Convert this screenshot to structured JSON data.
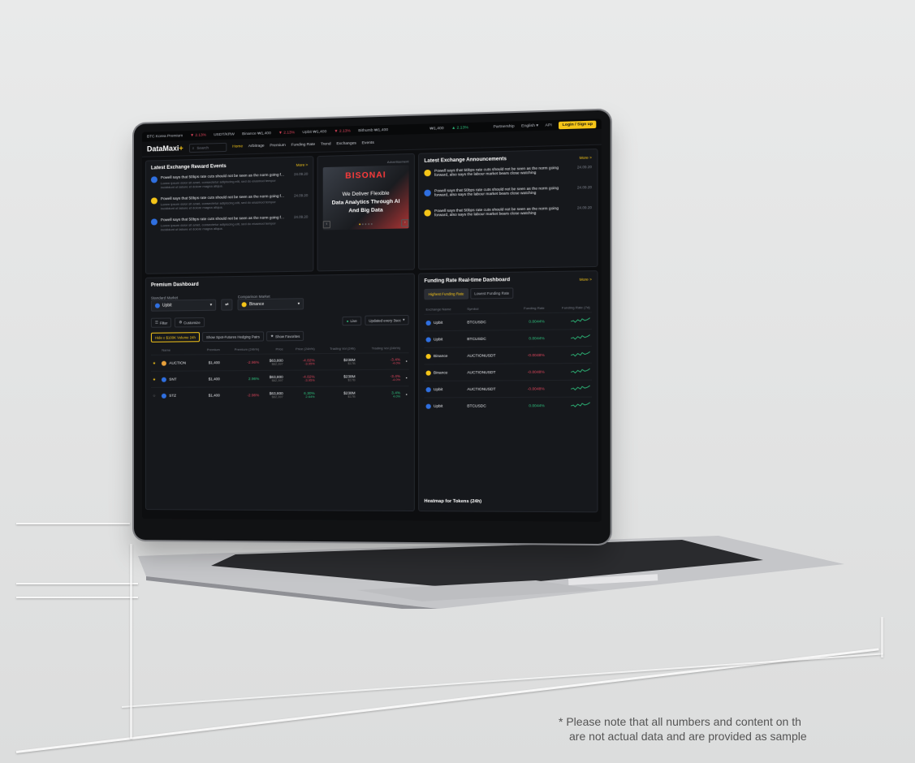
{
  "ticker": {
    "kp_label": "BTC Korea Premium",
    "kp_value": "▼ 2.13%",
    "usd_label": "USDT/KRW",
    "binance": "Binance ₩1,400",
    "binance_change": "▼ 2.13%",
    "upbit": "Upbit ₩1,400",
    "upbit_change": "▼ 2.13%",
    "bithumb": "Bithumb ₩1,400",
    "center": "₩1,400",
    "center_change": "▲ 2.13%",
    "partnership": "Partnership",
    "language": "English",
    "api": "API",
    "login": "Login / Sign up"
  },
  "nav": {
    "logo_main": "DataMaxi",
    "logo_plus": "+",
    "search_placeholder": "Search",
    "items": [
      "Home",
      "Arbitrage",
      "Premium",
      "Funding Rate",
      "Trend",
      "Exchanges",
      "Events"
    ]
  },
  "rewards": {
    "title": "Latest Exchange Reward Events",
    "more": "More >",
    "events": [
      {
        "title": "Powell says that 50bps rate cuts should not be seen as the norm going f...",
        "desc": "Lorem ipsum dolor sit amet, consectetur adipiscing elit, sed do eiusmod tempor incididunt ut labore et dolore magna aliqua.",
        "date": "24.09.20",
        "color": "#2f6fe0"
      },
      {
        "title": "Powell says that 50bps rate cuts should not be seen as the norm going f...",
        "desc": "Lorem ipsum dolor sit amet, consectetur adipiscing elit, sed do eiusmod tempor incididunt ut labore et dolore magna aliqua.",
        "date": "24.09.20",
        "color": "#f5c518"
      },
      {
        "title": "Powell says that 50bps rate cuts should not be seen as the norm going f...",
        "desc": "Lorem ipsum dolor sit amet, consectetur adipiscing elit, sed do eiusmod tempor incididunt ut labore et dolore magna aliqua.",
        "date": "24.09.20",
        "color": "#2f6fe0"
      }
    ]
  },
  "ad": {
    "label": "Advertisement",
    "brand": "BISONAI",
    "line1": "We Deliver Flexible",
    "line2": "Data Analytics Through AI",
    "line3": "And Big Data"
  },
  "announcements": {
    "title": "Latest Exchange Announcements",
    "more": "More >",
    "items": [
      {
        "text": "Powell says that 50bps rate cuts should not be seen as the norm going forward, also says the labour market bears close watching",
        "date": "24.09.20",
        "color": "#f5c518"
      },
      {
        "text": "Powell says that 50bps rate cuts should not be seen as the norm going forward, also says the labour market bears close watching",
        "date": "24.09.20",
        "color": "#2f6fe0"
      },
      {
        "text": "Powell says that 50bps rate cuts should not be seen as the norm going forward, also says the labour market bears close watching",
        "date": "24.09.20",
        "color": "#f5c518"
      }
    ]
  },
  "premium": {
    "title": "Premium Dashboard",
    "standard_label": "Standard Market",
    "standard_value": "Upbit",
    "comparison_label": "Comparison Market",
    "comparison_value": "Binance",
    "filter": "Filter",
    "customize": "Customize",
    "live": "Live",
    "updated": "Updated every 3sec",
    "chip_hide": "Hide ≤ $100K Volume 24h",
    "chip_spot": "Show Spot-Futures Hedging Pairs",
    "chip_fav": "Show Favorites",
    "headers": [
      "Name",
      "Premium",
      "Premium (24h%)",
      "Price",
      "Price (24h%)",
      "Trading Vol (24h)",
      "Trading Vol (24h%)"
    ],
    "rows": [
      {
        "name": "AUCTION",
        "premium": "$1,400",
        "prem_pct": "-2.96%",
        "price": "$63,800",
        "price_sub": "$62,397",
        "chg": "-4.02%",
        "chg_sub": "-3.95%",
        "vol": "$238M",
        "vol_sub": "$17B",
        "vol_pct": "-3.4%",
        "vol_pct_sub": "-4.0%"
      },
      {
        "name": "SNT",
        "premium": "$1,400",
        "prem_pct": "2.96%",
        "price": "$63,800",
        "price_sub": "$62,397",
        "chg": "-4.02%",
        "chg_sub": "-3.95%",
        "vol": "$238M",
        "vol_sub": "$17B",
        "vol_pct": "-3.4%",
        "vol_pct_sub": "-4.0%"
      },
      {
        "name": "STZ",
        "premium": "$1,400",
        "prem_pct": "-2.96%",
        "price": "$63,800",
        "price_sub": "$62,397",
        "chg": "6.30%",
        "chg_sub": "2.64%",
        "vol": "$238M",
        "vol_sub": "$17B",
        "vol_pct": "3.4%",
        "vol_pct_sub": "4.0%"
      }
    ]
  },
  "funding": {
    "title": "Funding Rate Real-time Dashboard",
    "more": "More >",
    "tab_high": "Highest Funding Rate",
    "tab_low": "Lowest Funding Rate",
    "headers": [
      "Exchange Name",
      "Symbol",
      "Funding Rate",
      "Funding Rate (7d)"
    ],
    "rows": [
      {
        "ex": "Upbit",
        "sym": "BTCUSDC",
        "rate": "0.0044%",
        "pos": true
      },
      {
        "ex": "Upbit",
        "sym": "BTCUSDC",
        "rate": "0.0044%",
        "pos": true
      },
      {
        "ex": "Binance",
        "sym": "AUCTIONUSDT",
        "rate": "-0.0048%",
        "pos": false
      },
      {
        "ex": "Binance",
        "sym": "AUCTIONUSDT",
        "rate": "-0.0048%",
        "pos": false
      },
      {
        "ex": "Upbit",
        "sym": "AUCTIONUSDT",
        "rate": "-0.0048%",
        "pos": false
      },
      {
        "ex": "Upbit",
        "sym": "BTCUSDC",
        "rate": "0.0044%",
        "pos": true
      }
    ],
    "heatmap_title": "Heatmap for Tokens (24h)"
  },
  "footnote": {
    "line1": "* Please note that all numbers and content on th",
    "line2": "are not actual data and are provided as sample"
  }
}
